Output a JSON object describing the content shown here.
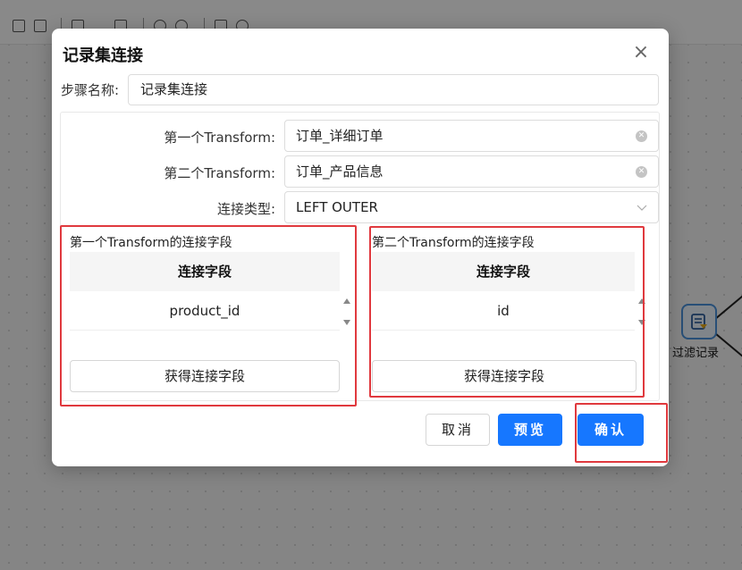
{
  "dialog": {
    "title": "记录集连接",
    "close_symbol": "×",
    "step_name_label": "步骤名称:",
    "step_name_value": "记录集连接",
    "first_transform_label": "第一个Transform:",
    "first_transform_value": "订单_详细订单",
    "second_transform_label": "第二个Transform:",
    "second_transform_value": "订单_产品信息",
    "join_type_label": "连接类型:",
    "join_type_value": "LEFT OUTER",
    "left_fields": {
      "title": "第一个Transform的连接字段",
      "header": "连接字段",
      "rows": [
        "product_id"
      ],
      "button": "获得连接字段"
    },
    "right_fields": {
      "title": "第二个Transform的连接字段",
      "header": "连接字段",
      "rows": [
        "id"
      ],
      "button": "获得连接字段"
    },
    "buttons": {
      "cancel": "取消",
      "preview": "预览",
      "confirm": "确认"
    }
  },
  "canvas": {
    "node_label": "过滤记录"
  },
  "colors": {
    "primary": "#1677ff",
    "highlight": "#e0393e"
  }
}
